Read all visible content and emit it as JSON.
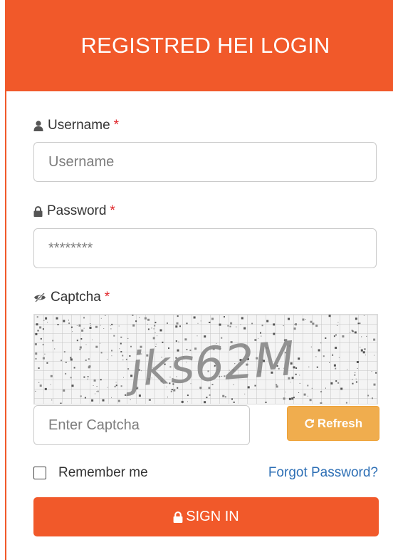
{
  "header": {
    "title": "REGISTRED HEI LOGIN"
  },
  "username": {
    "label": "Username",
    "required_mark": "*",
    "placeholder": "Username",
    "value": ""
  },
  "password": {
    "label": "Password",
    "required_mark": "*",
    "placeholder": "********",
    "value": ""
  },
  "captcha": {
    "label": "Captcha",
    "required_mark": "*",
    "image_text": "jks62M",
    "placeholder": "Enter Captcha",
    "value": "",
    "refresh_label": "Refresh"
  },
  "remember": {
    "label": "Remember me",
    "checked": false
  },
  "forgot_password": {
    "label": "Forgot Password?"
  },
  "signin": {
    "label": "SIGN IN"
  },
  "colors": {
    "brand": "#f1592a",
    "warning": "#f0ad4e",
    "link": "#2d6fb5",
    "required": "#e0272b"
  },
  "icons": {
    "username": "user-icon",
    "password": "lock-icon",
    "captcha": "eye-slash-icon",
    "refresh": "refresh-icon",
    "signin": "lock-icon"
  }
}
